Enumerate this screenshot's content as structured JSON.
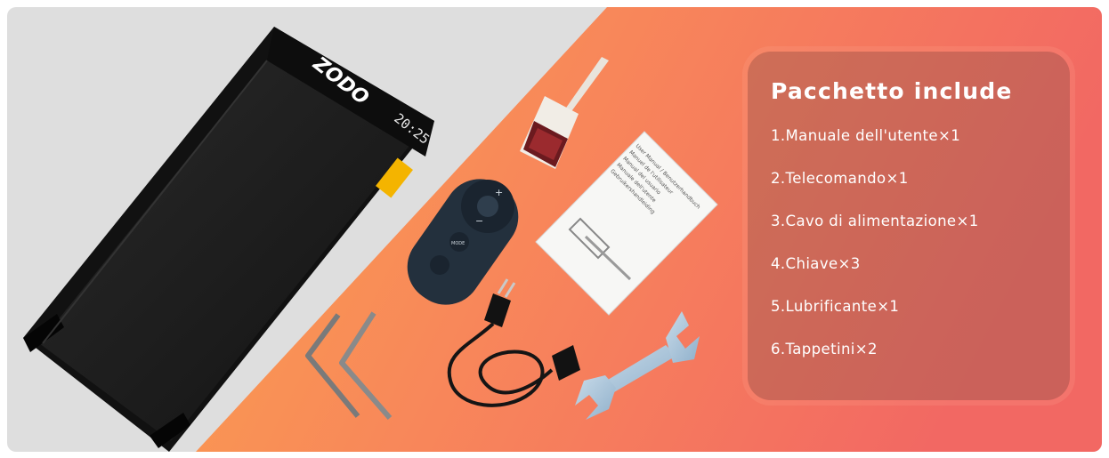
{
  "brand": {
    "logo_text": "ZODO",
    "display_time": "20:25"
  },
  "remote": {
    "plus_symbol": "+",
    "minus_symbol": "−",
    "mode_label": "MODE"
  },
  "manual": {
    "cover_lines": [
      "User Manual / Benutzerhandbuch",
      "Manuel de l'utilisateur",
      "Manual del usuario",
      "Manuale dell'utente",
      "Gebruikershandleiding"
    ]
  },
  "package": {
    "title": "Pacchetto include",
    "items": [
      "1.Manuale dell'utente×1",
      "2.Telecomando×1",
      "3.Cavo di alimentazione×1",
      "4.Chiave×3",
      "5.Lubrificante×1",
      "6.Tappetini×2"
    ]
  },
  "colors": {
    "left_bg": "#dedede",
    "gradient_start": "#fb9a50",
    "gradient_end": "#f26a63",
    "treadmill": "#1c1c1c",
    "accent_yellow": "#f4b400"
  }
}
